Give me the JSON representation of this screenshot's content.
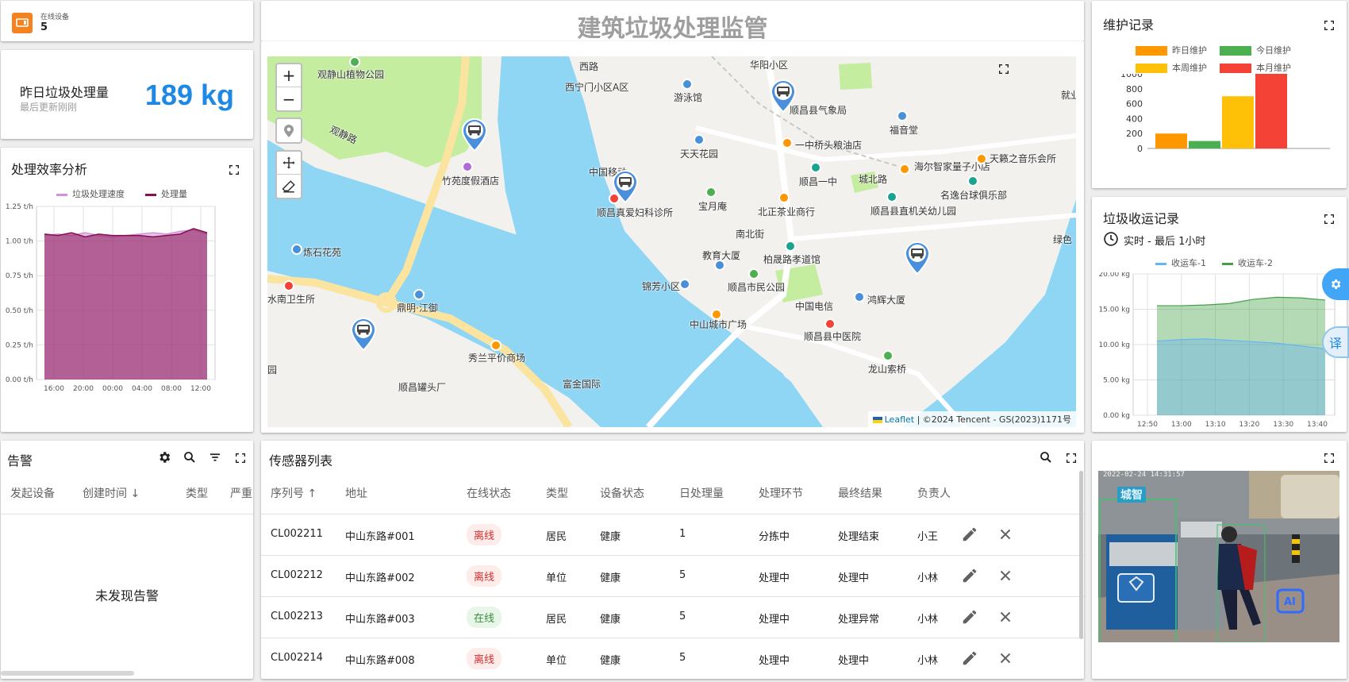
{
  "header": {
    "title": "建筑垃圾处理监管"
  },
  "online_devices": {
    "label": "在线设备",
    "value": "5",
    "icon": "device-icon",
    "color": "#f58220"
  },
  "daily_amount": {
    "label": "昨日垃圾处理量",
    "sub": "最后更新刚刚",
    "value": "189 kg",
    "color": "#1e88e5"
  },
  "efficiency": {
    "title": "处理效率分析",
    "chart_data": {
      "type": "area",
      "series": [
        {
          "name": "垃圾处理速度",
          "color": "#ce93d8",
          "values": [
            1.04,
            1.05,
            1.04,
            1.06,
            1.04,
            1.03,
            1.04,
            1.05,
            1.06,
            1.05,
            1.07,
            1.08,
            1.05
          ]
        },
        {
          "name": "处理量",
          "color": "#880e4f",
          "values": [
            1.05,
            1.04,
            1.06,
            1.03,
            1.05,
            1.04,
            1.04,
            1.04,
            1.03,
            1.04,
            1.05,
            1.09,
            1.06
          ]
        }
      ],
      "x_ticks": [
        "16:00",
        "20:00",
        "00:00",
        "04:00",
        "08:00",
        "12:00"
      ],
      "y_ticks": [
        "0.00 t/h",
        "0.25 t/h",
        "0.50 t/h",
        "0.75 t/h",
        "1.00 t/h",
        "1.25 t/h"
      ],
      "ylim": [
        0,
        1.25
      ],
      "legend": "top"
    }
  },
  "map": {
    "zoom_in": "+",
    "zoom_out": "−",
    "attribution_leaflet": "Leaflet",
    "attribution_rest": " | ©2024 Tencent - GS(2023)1171号",
    "labels": [
      "观静山植物公园",
      "西宁门小区A区",
      "华阳小区",
      "游泳馆",
      "顺昌县气象局",
      "福音堂",
      "观静路",
      "竹苑度假酒店",
      "天天花园",
      "一中桥头粮油店",
      "中国移动",
      "海尔智家量子小店",
      "天籁之音乐会所",
      "顺昌一中",
      "城北路",
      "宝月庵",
      "顺昌真爱妇科诊所",
      "北正茶业商行",
      "顺昌县直机关幼儿园",
      "名逸台球俱乐部",
      "炼石花苑",
      "南北街",
      "教育大厦",
      "柏晟路孝道馆",
      "绿色",
      "水南卫生所",
      "锦芳小区",
      "顺昌市民公园",
      "鸿辉大厦",
      "鼎明·江御",
      "中国电信",
      "中山城市广场",
      "顺昌县中医院",
      "秀兰平价商场",
      "龙山索桥",
      "顺昌罐头厂",
      "富金国际",
      "就业",
      "西路",
      "园"
    ]
  },
  "maintenance": {
    "title": "维护记录",
    "chart_data": {
      "type": "bar",
      "series": [
        {
          "name": "昨日维护",
          "color": "#ff9800",
          "values": [
            200
          ]
        },
        {
          "name": "今日维护",
          "color": "#4caf50",
          "values": [
            100
          ]
        },
        {
          "name": "本周维护",
          "color": "#ffc107",
          "values": [
            700
          ]
        },
        {
          "name": "本月维护",
          "color": "#f44336",
          "values": [
            1000
          ]
        }
      ],
      "y_ticks": [
        "0",
        "200",
        "400",
        "600",
        "800",
        "1000"
      ],
      "ylim": [
        0,
        1000
      ],
      "legend": "top"
    }
  },
  "collection": {
    "title": "垃圾收运记录",
    "time_label": "实时 - 最后 1小时",
    "chart_data": {
      "type": "area",
      "series": [
        {
          "name": "收运车-1",
          "color": "#64b5f6",
          "values": [
            10.5,
            10.7,
            10.8,
            10.6,
            10.4,
            10.2,
            9.8,
            9.4
          ]
        },
        {
          "name": "收运车-2",
          "color": "#43a047",
          "values": [
            15.5,
            15.5,
            15.6,
            15.8,
            16.4,
            16.7,
            16.6,
            16.3
          ]
        }
      ],
      "x_ticks": [
        "12:50",
        "13:00",
        "13:10",
        "13:20",
        "13:30",
        "13:40"
      ],
      "y_ticks": [
        "0.00 kg",
        "5.00 kg",
        "10.00 kg",
        "15.00 kg",
        "20.00 kg"
      ],
      "ylim": [
        0,
        20
      ],
      "legend": "top"
    }
  },
  "alarm": {
    "title": "告警",
    "columns": [
      "发起设备",
      "创建时间",
      "类型",
      "严重"
    ],
    "empty": "未发现告警"
  },
  "sensors": {
    "title": "传感器列表",
    "columns": [
      "序列号",
      "地址",
      "在线状态",
      "类型",
      "设备状态",
      "日处理量",
      "处理环节",
      "最终结果",
      "负责人"
    ],
    "rows": [
      {
        "serial": "CL002211",
        "address": "中山东路#001",
        "online": "离线",
        "online_state": "off",
        "type": "居民",
        "status": "健康",
        "daily": "1",
        "stage": "分拣中",
        "result": "处理结束",
        "owner": "小王"
      },
      {
        "serial": "CL002212",
        "address": "中山东路#002",
        "online": "离线",
        "online_state": "off",
        "type": "单位",
        "status": "健康",
        "daily": "5",
        "stage": "处理中",
        "result": "处理中",
        "owner": "小林"
      },
      {
        "serial": "CL002213",
        "address": "中山东路#003",
        "online": "在线",
        "online_state": "on",
        "type": "居民",
        "status": "健康",
        "daily": "5",
        "stage": "处理中",
        "result": "处理异常",
        "owner": "小林"
      },
      {
        "serial": "CL002214",
        "address": "中山东路#008",
        "online": "离线",
        "online_state": "off",
        "type": "单位",
        "status": "健康",
        "daily": "5",
        "stage": "处理中",
        "result": "处理中",
        "owner": "小林"
      }
    ]
  },
  "video": {
    "timestamp": "2022-02-24 14:31:57",
    "logo": "城智",
    "badge": "AI"
  },
  "side": {
    "translate": "译"
  }
}
